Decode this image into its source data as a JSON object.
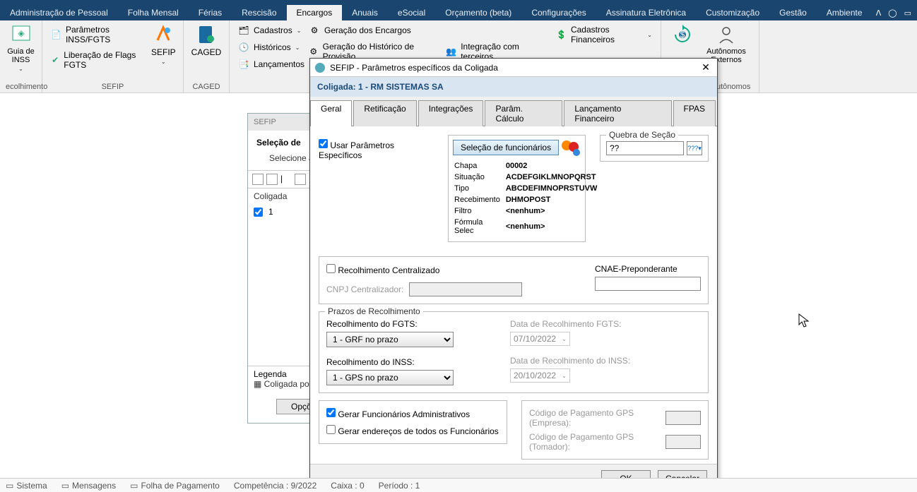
{
  "menu": {
    "items": [
      "Administração de Pessoal",
      "Folha Mensal",
      "Férias",
      "Rescisão",
      "Encargos",
      "Anuais",
      "eSocial",
      "Orçamento (beta)",
      "Configurações",
      "Assinatura Eletrônica",
      "Customização",
      "Gestão",
      "Ambiente"
    ],
    "active": 4
  },
  "ribbon": {
    "g0": {
      "label": "ecolhimento",
      "btn": "Guia de\nINSS"
    },
    "g1": {
      "label": "SEFIP",
      "a": "Parâmetros INSS/FGTS",
      "b": "Liberação de Flags FGTS",
      "c": "SEFIP"
    },
    "g2": {
      "label": "CAGED",
      "a": "CAGED"
    },
    "g3": {
      "a": "Cadastros",
      "b": "Históricos",
      "c": "Lançamentos"
    },
    "g4": {
      "a": "Geração dos Encargos",
      "b": "Geração do Histórico de Provisão",
      "c": "Integração com terceiros"
    },
    "g5": {
      "a": "Cadastros Financeiros"
    },
    "g6": {
      "label": "Autônomos",
      "a": "Autônomos\nExternos"
    }
  },
  "sidepanel": {
    "title": "SEFIP",
    "sub": "Seleção de",
    "desc": "Selecione a",
    "gridhead": "Coligada",
    "row_val": "1",
    "legend": "Legenda",
    "legend_item": "Coligada po",
    "opcoes": "Opções"
  },
  "dialog": {
    "title": "SEFIP - Parâmetros específicos da Coligada",
    "banner": "Coligada: 1 - RM SISTEMAS SA",
    "tabs": [
      "Geral",
      "Retificação",
      "Integrações",
      "Parâm. Cálculo",
      "Lançamento Financeiro",
      "FPAS"
    ],
    "chk_usar": "Usar Parâmetros Específicos",
    "btn_sel": "Seleção de funcionários",
    "kv": {
      "Chapa": "00002",
      "Situação": "ACDEFGIKLMNOPQRST",
      "Tipo": "ABCDEFIMNOPRSTUVW",
      "Recebimento": "DHMOPOST",
      "Filtro": "<nenhum>",
      "Fórmula Selec": "<nenhum>"
    },
    "quebra_label": "Quebra de Seção",
    "quebra_val": "??",
    "rec_cent": "Recolhimento Centralizado",
    "cnpj_cent": "CNPJ Centralizador:",
    "cnae": "CNAE-Preponderante",
    "prazos": "Prazos de Recolhimento",
    "rec_fgts": "Recolhimento do FGTS:",
    "rec_fgts_val": "1 - GRF no prazo",
    "data_fgts_lbl": "Data de Recolhimento FGTS:",
    "data_fgts": "07/10/2022",
    "rec_inss": "Recolhimento do INSS:",
    "rec_inss_val": "1 - GPS no prazo",
    "data_inss_lbl": "Data de Recolhimento do INSS:",
    "data_inss": "20/10/2022",
    "chk_admin": "Gerar Funcionários Administrativos",
    "chk_ender": "Gerar endereços de todos os Funcionários",
    "cod_gps_emp": "Código de Pagamento GPS (Empresa):",
    "cod_gps_tom": "Código de Pagamento GPS (Tomador):",
    "ok": "OK",
    "cancel": "Cancelar"
  },
  "status": {
    "a": "Sistema",
    "b": "Mensagens",
    "c": "Folha de Pagamento",
    "d": "Competência : 9/2022",
    "e": "Caixa : 0",
    "f": "Período : 1"
  }
}
